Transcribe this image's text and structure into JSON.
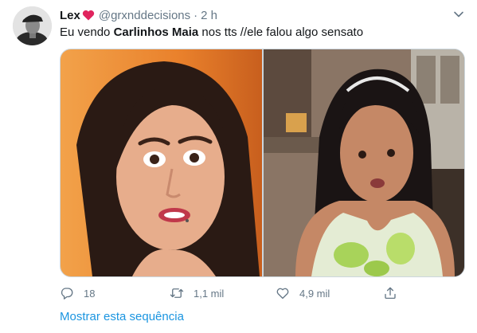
{
  "tweet": {
    "display_name": "Lex",
    "handle": "@grxnddecisions",
    "separator": "·",
    "time": "2 h",
    "text_before": "Eu vendo ",
    "text_bold": "Carlinhos Maia",
    "text_after": " nos tts //ele falou algo sensato"
  },
  "actions": {
    "reply_count": "18",
    "retweet_count": "1,1 mil",
    "like_count": "4,9 mil"
  },
  "show_thread_label": "Mostrar esta sequência",
  "colors": {
    "accent": "#1b95e0",
    "heart": "#e0245e",
    "muted": "#657786"
  },
  "icons": [
    "heart-icon",
    "caret-down-icon",
    "reply-icon",
    "retweet-icon",
    "like-icon",
    "share-icon"
  ]
}
